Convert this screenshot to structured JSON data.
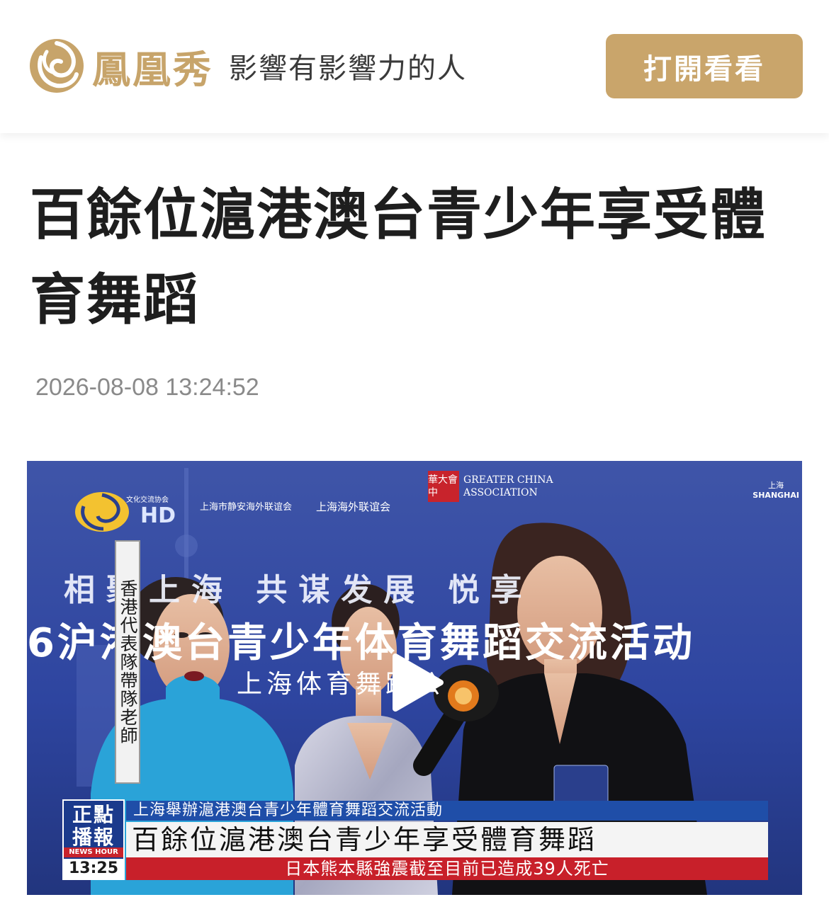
{
  "header": {
    "brand_name": "鳳凰秀",
    "slogan": "影響有影響力的人",
    "open_button": "打開看看"
  },
  "article": {
    "title": "百餘位滬港澳台青少年享受體育舞蹈",
    "timestamp": "2026-08-08 13:24:52"
  },
  "video": {
    "hd_label": "HD",
    "sponsors": [
      "文化交流协会",
      "上海市静安海外联谊会",
      "上海海外联谊会"
    ],
    "gca_box": "華大會中",
    "gca_text_1": "GREATER CHINA",
    "gca_text_2": "ASSOCIATION",
    "shanghai_cn": "上海",
    "shanghai_en": "SHANGHAI",
    "backdrop_slogan": "相聚上海 共谋发展 悦享",
    "backdrop_banner": "6沪港澳台青少年体育舞蹈交流活动",
    "backdrop_sub": "上海体育舞蹈公",
    "vertical_caption": "香港代表隊帶隊老師",
    "lower_third": {
      "show_name_1": "正點",
      "show_name_2": "播報",
      "show_en": "NEWS HOUR",
      "clock": "13:25",
      "topic": "上海舉辦滬港澳台青少年體育舞蹈交流活動",
      "headline": "百餘位滬港澳台青少年享受體育舞蹈",
      "ticker": "日本熊本縣強震截至目前已造成39人死亡"
    }
  },
  "colors": {
    "brand_gold": "#c9a56b",
    "title_text": "#1e1e1e",
    "timestamp_text": "#8a8a8a",
    "video_blue": "#2a3f8c",
    "ticker_red": "#c8202a"
  }
}
